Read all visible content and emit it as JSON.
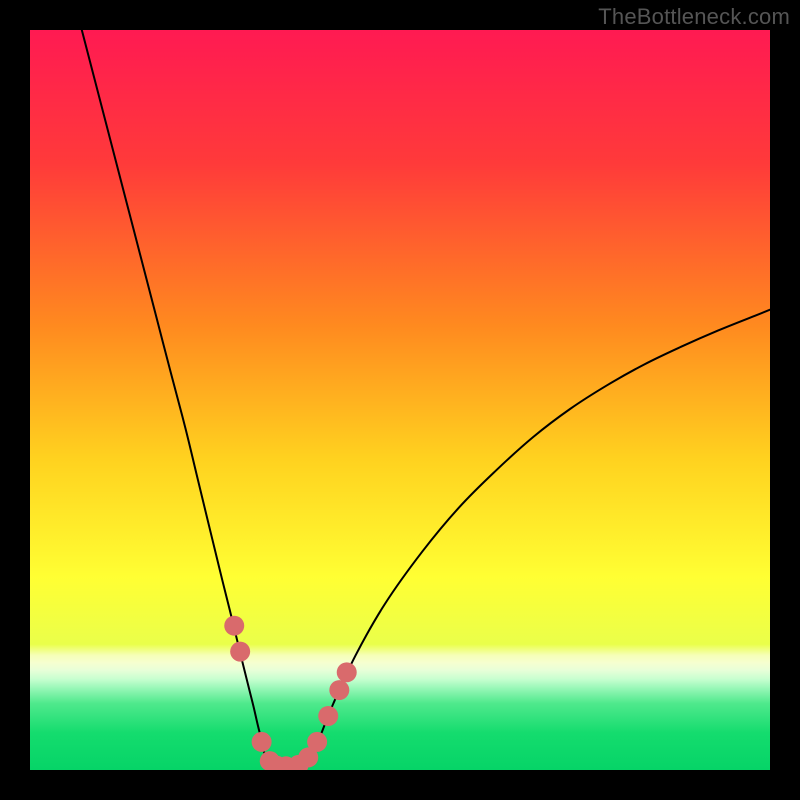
{
  "watermark": "TheBottleneck.com",
  "chart_data": {
    "type": "line",
    "title": "",
    "xlabel": "",
    "ylabel": "",
    "xlim": [
      0,
      100
    ],
    "ylim": [
      0,
      100
    ],
    "gradient_stops": [
      {
        "offset": 0.0,
        "color": "#ff1a52"
      },
      {
        "offset": 0.18,
        "color": "#ff3a3a"
      },
      {
        "offset": 0.4,
        "color": "#ff8a1f"
      },
      {
        "offset": 0.58,
        "color": "#ffd21f"
      },
      {
        "offset": 0.74,
        "color": "#ffff33"
      },
      {
        "offset": 0.83,
        "color": "#eaff4a"
      },
      {
        "offset": 0.845,
        "color": "#f6ffb8"
      },
      {
        "offset": 0.855,
        "color": "#f6ffd0"
      },
      {
        "offset": 0.865,
        "color": "#e8ffd8"
      },
      {
        "offset": 0.877,
        "color": "#c8ffd0"
      },
      {
        "offset": 0.89,
        "color": "#96f7b6"
      },
      {
        "offset": 0.91,
        "color": "#4fe98c"
      },
      {
        "offset": 0.95,
        "color": "#14dc6e"
      },
      {
        "offset": 1.0,
        "color": "#06d467"
      }
    ],
    "series": [
      {
        "name": "left-curve",
        "color": "#000000",
        "x": [
          7.0,
          9.0,
          11.0,
          13.0,
          15.0,
          17.0,
          19.0,
          21.0,
          22.5,
          24.0,
          25.0,
          26.0,
          27.0,
          28.0,
          28.8,
          29.6,
          30.2,
          30.8,
          31.4,
          32.0
        ],
        "y": [
          100,
          92.3,
          84.6,
          76.9,
          69.2,
          61.5,
          53.8,
          46.2,
          40.0,
          33.8,
          29.7,
          25.6,
          21.6,
          17.5,
          14.2,
          11.0,
          8.6,
          6.0,
          3.6,
          1.0
        ]
      },
      {
        "name": "valley-floor",
        "color": "#000000",
        "x": [
          32.0,
          33.0,
          34.0,
          35.0,
          36.0,
          37.0,
          37.8
        ],
        "y": [
          1.0,
          0.5,
          0.3,
          0.3,
          0.3,
          0.5,
          1.0
        ]
      },
      {
        "name": "right-curve",
        "color": "#000000",
        "x": [
          37.8,
          39.0,
          41.0,
          44.0,
          48.0,
          53.0,
          58.0,
          63.0,
          68.0,
          73.0,
          78.0,
          83.0,
          88.0,
          93.0,
          98.0,
          100.0
        ],
        "y": [
          1.0,
          4.0,
          9.0,
          15.5,
          22.5,
          29.5,
          35.5,
          40.5,
          45.0,
          48.8,
          52.0,
          54.8,
          57.2,
          59.4,
          61.4,
          62.2
        ]
      }
    ],
    "markers": {
      "name": "bottleneck-markers",
      "color": "#d96a6c",
      "radius_pct": 1.35,
      "points": [
        {
          "x": 27.6,
          "y": 19.5
        },
        {
          "x": 28.4,
          "y": 16.0
        },
        {
          "x": 31.3,
          "y": 3.8
        },
        {
          "x": 32.4,
          "y": 1.2
        },
        {
          "x": 33.3,
          "y": 0.6
        },
        {
          "x": 34.6,
          "y": 0.5
        },
        {
          "x": 36.3,
          "y": 0.7
        },
        {
          "x": 37.6,
          "y": 1.7
        },
        {
          "x": 38.8,
          "y": 3.8
        },
        {
          "x": 40.3,
          "y": 7.3
        },
        {
          "x": 41.8,
          "y": 10.8
        },
        {
          "x": 42.8,
          "y": 13.2
        }
      ]
    }
  }
}
